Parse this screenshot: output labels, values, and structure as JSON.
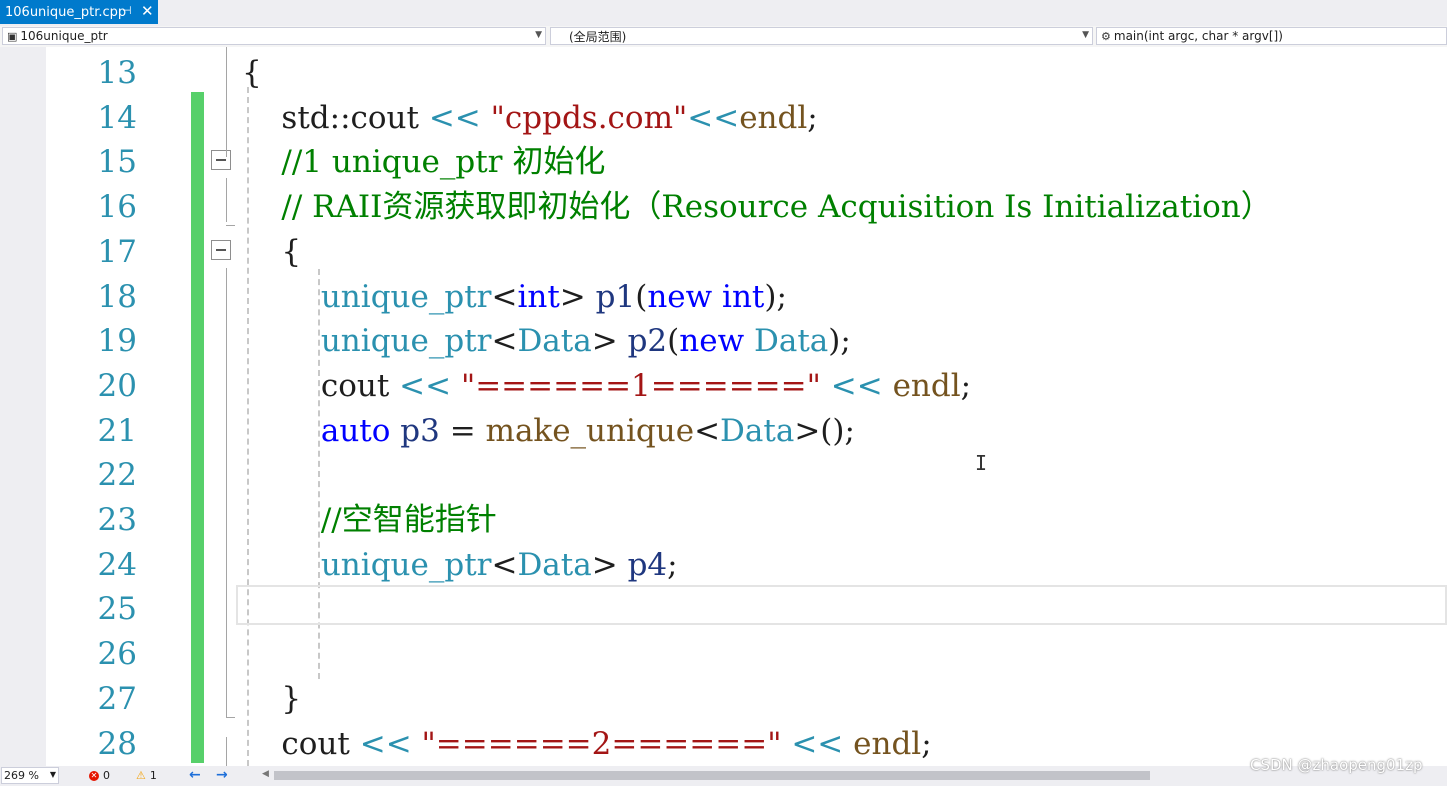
{
  "tab": {
    "title": "106unique_ptr.cpp",
    "pin_glyph": "⊣",
    "close_glyph": "✕"
  },
  "nav": {
    "project": "106unique_ptr",
    "scope": "(全局范围)",
    "member": "main(int argc, char * argv[])"
  },
  "editor": {
    "lines": [
      {
        "num": "13",
        "tokens": [
          {
            "t": "{",
            "c": ""
          }
        ]
      },
      {
        "num": "14",
        "tokens": [
          {
            "t": "    std::cout ",
            "c": ""
          },
          {
            "t": "<<",
            "c": "ty"
          },
          {
            "t": " ",
            "c": ""
          },
          {
            "t": "\"cppds.com\"",
            "c": "str"
          },
          {
            "t": "<<",
            "c": "ty"
          },
          {
            "t": "endl",
            "c": "fn"
          },
          {
            "t": ";",
            "c": ""
          }
        ]
      },
      {
        "num": "15",
        "tokens": [
          {
            "t": "    //1 unique_ptr 初始化",
            "c": "cm"
          }
        ]
      },
      {
        "num": "16",
        "tokens": [
          {
            "t": "    // RAII资源获取即初始化（Resource Acquisition Is Initialization）",
            "c": "cm"
          }
        ]
      },
      {
        "num": "17",
        "tokens": [
          {
            "t": "    {",
            "c": ""
          }
        ]
      },
      {
        "num": "18",
        "tokens": [
          {
            "t": "        ",
            "c": ""
          },
          {
            "t": "unique_ptr",
            "c": "ty"
          },
          {
            "t": "<",
            "c": ""
          },
          {
            "t": "int",
            "c": "kw"
          },
          {
            "t": "> ",
            "c": ""
          },
          {
            "t": "p1",
            "c": "var"
          },
          {
            "t": "(",
            "c": ""
          },
          {
            "t": "new",
            "c": "kw"
          },
          {
            "t": " ",
            "c": ""
          },
          {
            "t": "int",
            "c": "kw"
          },
          {
            "t": ");",
            "c": ""
          }
        ]
      },
      {
        "num": "19",
        "tokens": [
          {
            "t": "        ",
            "c": ""
          },
          {
            "t": "unique_ptr",
            "c": "ty"
          },
          {
            "t": "<",
            "c": ""
          },
          {
            "t": "Data",
            "c": "ty"
          },
          {
            "t": "> ",
            "c": ""
          },
          {
            "t": "p2",
            "c": "var"
          },
          {
            "t": "(",
            "c": ""
          },
          {
            "t": "new",
            "c": "kw"
          },
          {
            "t": " ",
            "c": ""
          },
          {
            "t": "Data",
            "c": "ty"
          },
          {
            "t": ");",
            "c": ""
          }
        ]
      },
      {
        "num": "20",
        "tokens": [
          {
            "t": "        cout ",
            "c": ""
          },
          {
            "t": "<<",
            "c": "ty"
          },
          {
            "t": " ",
            "c": ""
          },
          {
            "t": "\"======1======\"",
            "c": "str"
          },
          {
            "t": " ",
            "c": ""
          },
          {
            "t": "<<",
            "c": "ty"
          },
          {
            "t": " ",
            "c": ""
          },
          {
            "t": "endl",
            "c": "fn"
          },
          {
            "t": ";",
            "c": ""
          }
        ]
      },
      {
        "num": "21",
        "tokens": [
          {
            "t": "        ",
            "c": ""
          },
          {
            "t": "auto",
            "c": "kw"
          },
          {
            "t": " ",
            "c": ""
          },
          {
            "t": "p3",
            "c": "var"
          },
          {
            "t": " = ",
            "c": ""
          },
          {
            "t": "make_unique",
            "c": "fn"
          },
          {
            "t": "<",
            "c": ""
          },
          {
            "t": "Data",
            "c": "ty"
          },
          {
            "t": ">();",
            "c": ""
          }
        ]
      },
      {
        "num": "22",
        "tokens": []
      },
      {
        "num": "23",
        "tokens": [
          {
            "t": "        //空智能指针",
            "c": "cm"
          }
        ]
      },
      {
        "num": "24",
        "tokens": [
          {
            "t": "        ",
            "c": ""
          },
          {
            "t": "unique_ptr",
            "c": "ty"
          },
          {
            "t": "<",
            "c": ""
          },
          {
            "t": "Data",
            "c": "ty"
          },
          {
            "t": "> ",
            "c": ""
          },
          {
            "t": "p4",
            "c": "var"
          },
          {
            "t": ";",
            "c": ""
          }
        ]
      },
      {
        "num": "25",
        "tokens": []
      },
      {
        "num": "26",
        "tokens": []
      },
      {
        "num": "27",
        "tokens": [
          {
            "t": "    }",
            "c": ""
          }
        ]
      },
      {
        "num": "28",
        "tokens": [
          {
            "t": "    cout ",
            "c": ""
          },
          {
            "t": "<<",
            "c": "ty"
          },
          {
            "t": " ",
            "c": ""
          },
          {
            "t": "\"======2======\"",
            "c": "str"
          },
          {
            "t": " ",
            "c": ""
          },
          {
            "t": "<<",
            "c": "ty"
          },
          {
            "t": " ",
            "c": ""
          },
          {
            "t": "endl",
            "c": "fn"
          },
          {
            "t": ";",
            "c": ""
          }
        ]
      }
    ],
    "changed_lines": [
      "14",
      "15",
      "16",
      "17",
      "18",
      "19",
      "20",
      "21",
      "22",
      "23",
      "24",
      "25",
      "26",
      "27",
      "28"
    ],
    "collapsible_lines": [
      "15",
      "17"
    ]
  },
  "status": {
    "zoom": "269 %",
    "errors": "0",
    "warnings": "1"
  },
  "watermark": "CSDN @zhaopeng01zp",
  "colors": {
    "accent": "#007acc",
    "line_number": "#2b91af",
    "change_bar": "#57d06a",
    "keyword": "#0000ff",
    "type": "#2b91af",
    "string": "#a31515",
    "comment": "#008000"
  }
}
